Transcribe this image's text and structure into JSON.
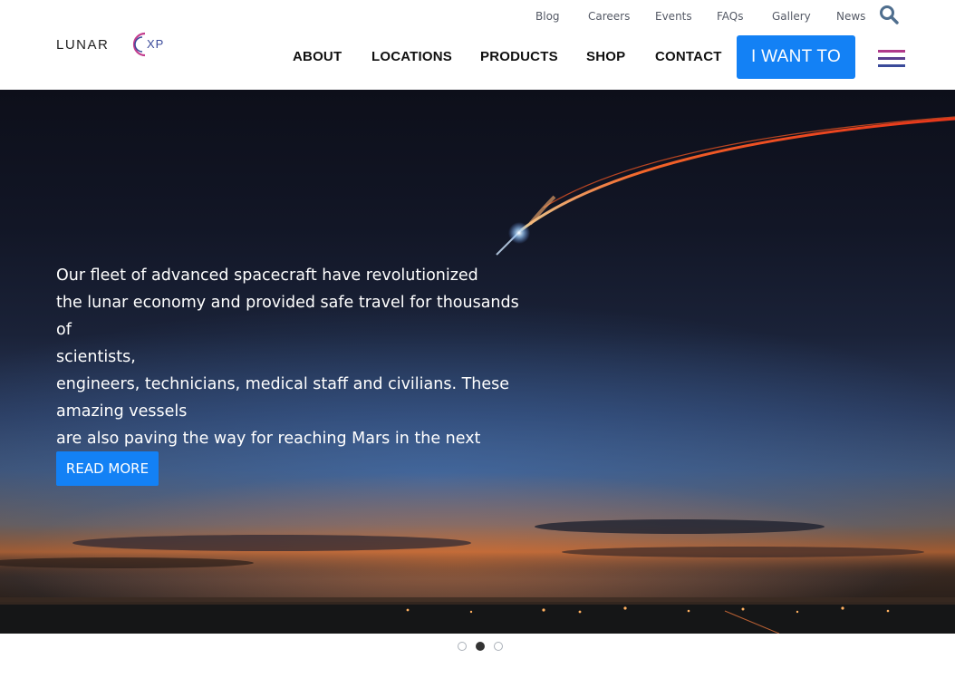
{
  "brand": {
    "logo_text_left": "LUNAR",
    "logo_text_right": "XP"
  },
  "top_links": [
    "Blog",
    "Careers",
    "Events",
    "FAQs",
    "Gallery",
    "News"
  ],
  "main_nav": [
    "ABOUT",
    "LOCATIONS",
    "PRODUCTS",
    "SHOP",
    "CONTACT"
  ],
  "cta": {
    "label": "I WANT TO"
  },
  "hero": {
    "lines": [
      "Our fleet of advanced spacecraft have revolutionized",
      "the lunar economy and provided safe travel for thousands of",
      "scientists,",
      "engineers, technicians, medical staff and civilians. These",
      "amazing vessels",
      "are also paving the way for reaching Mars in the next decade."
    ],
    "button_label": "READ MORE"
  },
  "carousel": {
    "slides": 3,
    "active_index": 1
  },
  "colors": {
    "accent": "#1381f5",
    "nav_text": "#111111",
    "menu_stripe_1": "#b03a8a",
    "menu_stripe_2": "#5a3e8e",
    "menu_stripe_3": "#3a4a9a"
  },
  "icons": {
    "search": "search-icon",
    "menu": "hamburger-menu-icon"
  }
}
